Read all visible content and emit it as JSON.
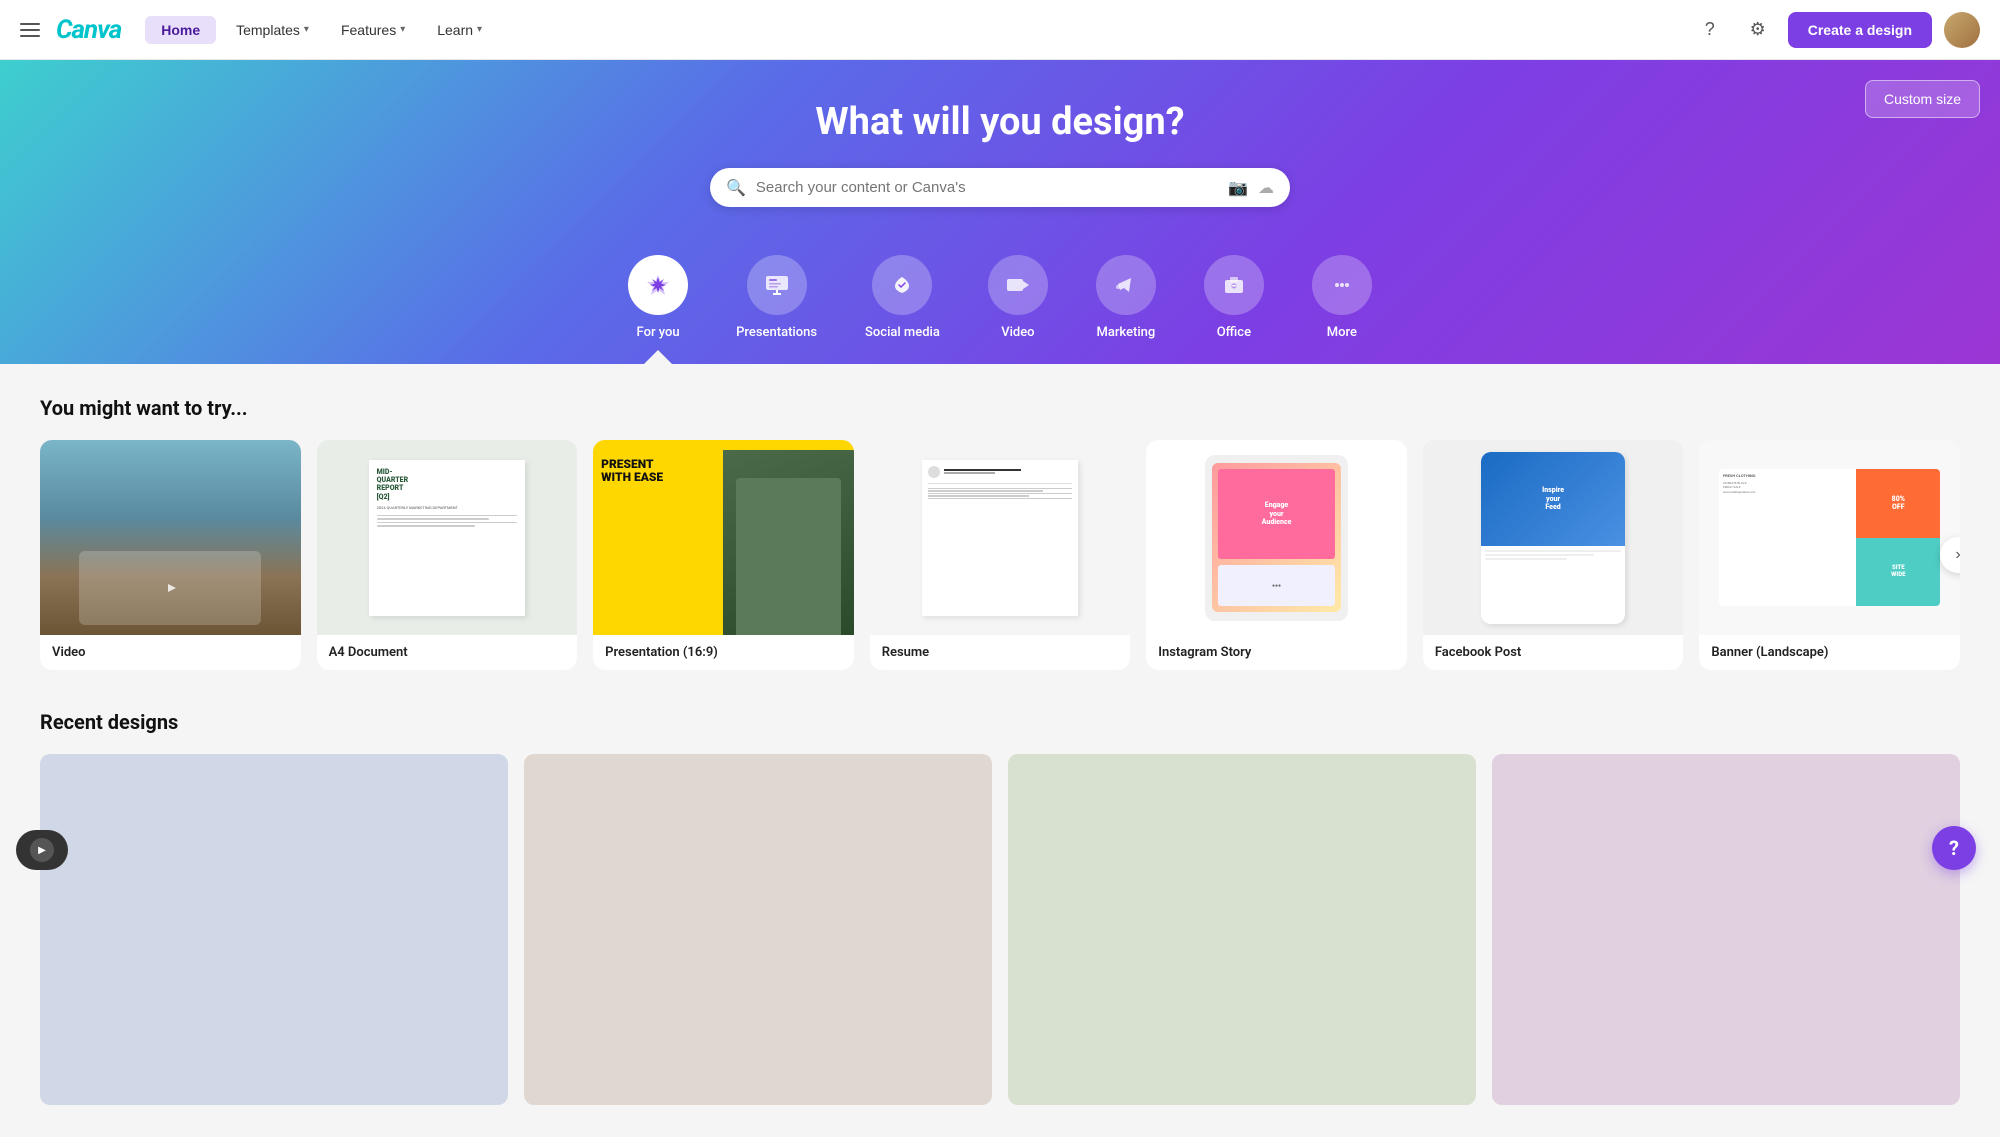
{
  "navbar": {
    "logo": "Canva",
    "home_label": "Home",
    "templates_label": "Templates",
    "features_label": "Features",
    "learn_label": "Learn",
    "create_label": "Create a design"
  },
  "hero": {
    "title": "What will you design?",
    "search_placeholder": "Search your content or Canva's",
    "custom_size_label": "Custom size"
  },
  "categories": [
    {
      "id": "for-you",
      "label": "For you",
      "icon": "✦",
      "active": true
    },
    {
      "id": "presentations",
      "label": "Presentations",
      "icon": "📊",
      "active": false
    },
    {
      "id": "social-media",
      "label": "Social media",
      "icon": "❤",
      "active": false
    },
    {
      "id": "video",
      "label": "Video",
      "icon": "▶",
      "active": false
    },
    {
      "id": "marketing",
      "label": "Marketing",
      "icon": "📣",
      "active": false
    },
    {
      "id": "office",
      "label": "Office",
      "icon": "💼",
      "active": false
    },
    {
      "id": "more",
      "label": "More",
      "icon": "•••",
      "active": false
    }
  ],
  "try_section": {
    "title": "You might want to try...",
    "items": [
      {
        "label": "Video",
        "thumb_type": "video"
      },
      {
        "label": "A4 Document",
        "thumb_type": "a4"
      },
      {
        "label": "Presentation (16:9)",
        "thumb_type": "presentation"
      },
      {
        "label": "Resume",
        "thumb_type": "resume"
      },
      {
        "label": "Instagram Story",
        "thumb_type": "instagram"
      },
      {
        "label": "Facebook Post",
        "thumb_type": "facebook"
      },
      {
        "label": "Banner (Landscape)",
        "thumb_type": "banner"
      }
    ]
  },
  "recent_section": {
    "title": "Recent designs"
  },
  "a4_doc": {
    "line1": "MID-",
    "line2": "QUARTER",
    "line3": "REPORT",
    "line4": "[Q2]",
    "line5": "2024 QUARTERLY MARKETING DEPARTMENT"
  },
  "pres_doc": {
    "line1": "PRESENT",
    "line2": "WITH EASE"
  },
  "insta_doc": {
    "line1": "Engage",
    "line2": "your",
    "line3": "Audience"
  },
  "fb_doc": {
    "line1": "Inspire",
    "line2": "your",
    "line3": "Feed"
  },
  "banner_doc": {
    "line1": "80%",
    "line2": "OFF",
    "line3": "SITE",
    "line4": "WIDE"
  }
}
